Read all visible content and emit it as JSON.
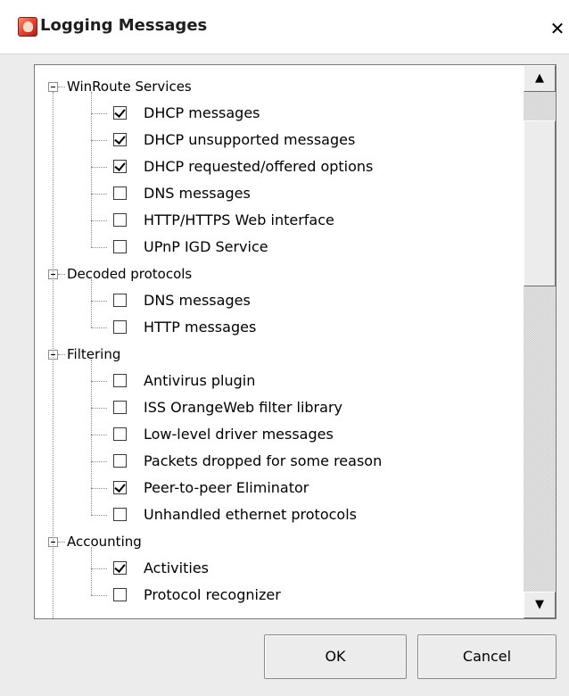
{
  "window": {
    "title": "Logging Messages",
    "close_glyph": "✕",
    "icon": "app-logo-icon"
  },
  "tree": {
    "groups": [
      {
        "label": "WinRoute Services",
        "expanded": true,
        "items": [
          {
            "label": "DHCP messages",
            "checked": true
          },
          {
            "label": "DHCP unsupported messages",
            "checked": true
          },
          {
            "label": "DHCP requested/offered options",
            "checked": true
          },
          {
            "label": "DNS messages",
            "checked": false
          },
          {
            "label": "HTTP/HTTPS Web interface",
            "checked": false
          },
          {
            "label": "UPnP IGD Service",
            "checked": false
          }
        ]
      },
      {
        "label": "Decoded protocols",
        "expanded": true,
        "items": [
          {
            "label": "DNS messages",
            "checked": false
          },
          {
            "label": "HTTP messages",
            "checked": false
          }
        ]
      },
      {
        "label": "Filtering",
        "expanded": true,
        "items": [
          {
            "label": "Antivirus plugin",
            "checked": false
          },
          {
            "label": "ISS OrangeWeb filter library",
            "checked": false
          },
          {
            "label": "Low-level driver messages",
            "checked": false
          },
          {
            "label": "Packets dropped for some reason",
            "checked": false
          },
          {
            "label": "Peer-to-peer Eliminator",
            "checked": true
          },
          {
            "label": "Unhandled ethernet protocols",
            "checked": false
          }
        ]
      },
      {
        "label": "Accounting",
        "expanded": true,
        "items": [
          {
            "label": "Activities",
            "checked": true
          },
          {
            "label": "Protocol recognizer",
            "checked": false
          }
        ]
      }
    ]
  },
  "scrollbar": {
    "up_glyph": "▲",
    "down_glyph": "▼",
    "position_fraction": 0.1
  },
  "buttons": {
    "ok_label": "OK",
    "cancel_label": "Cancel"
  },
  "colors": {
    "dialog_bg": "#ececec",
    "list_bg": "#ffffff",
    "title_text": "#1e1e1e"
  }
}
